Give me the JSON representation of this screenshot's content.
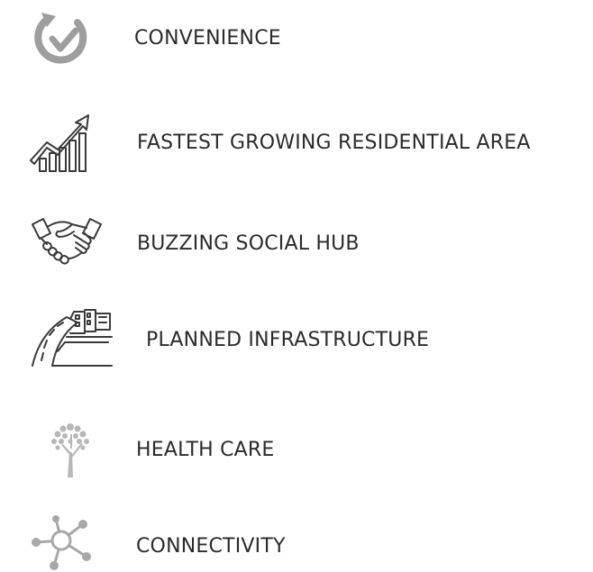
{
  "features": [
    {
      "label": "CONVENIENCE",
      "icon": "refresh-check-icon"
    },
    {
      "label": "FASTEST GROWING RESIDENTIAL AREA",
      "icon": "growth-chart-icon"
    },
    {
      "label": "BUZZING SOCIAL HUB",
      "icon": "handshake-icon"
    },
    {
      "label": "PLANNED INFRASTRUCTURE",
      "icon": "road-buildings-icon"
    },
    {
      "label": "HEALTH CARE",
      "icon": "tree-icon"
    },
    {
      "label": "CONNECTIVITY",
      "icon": "network-nodes-icon"
    }
  ],
  "colors": {
    "text": "#2b2b2b",
    "icon_fill": "#9e9e9e",
    "icon_stroke": "#3a3a3a",
    "icon_light": "#b7b7b7"
  }
}
